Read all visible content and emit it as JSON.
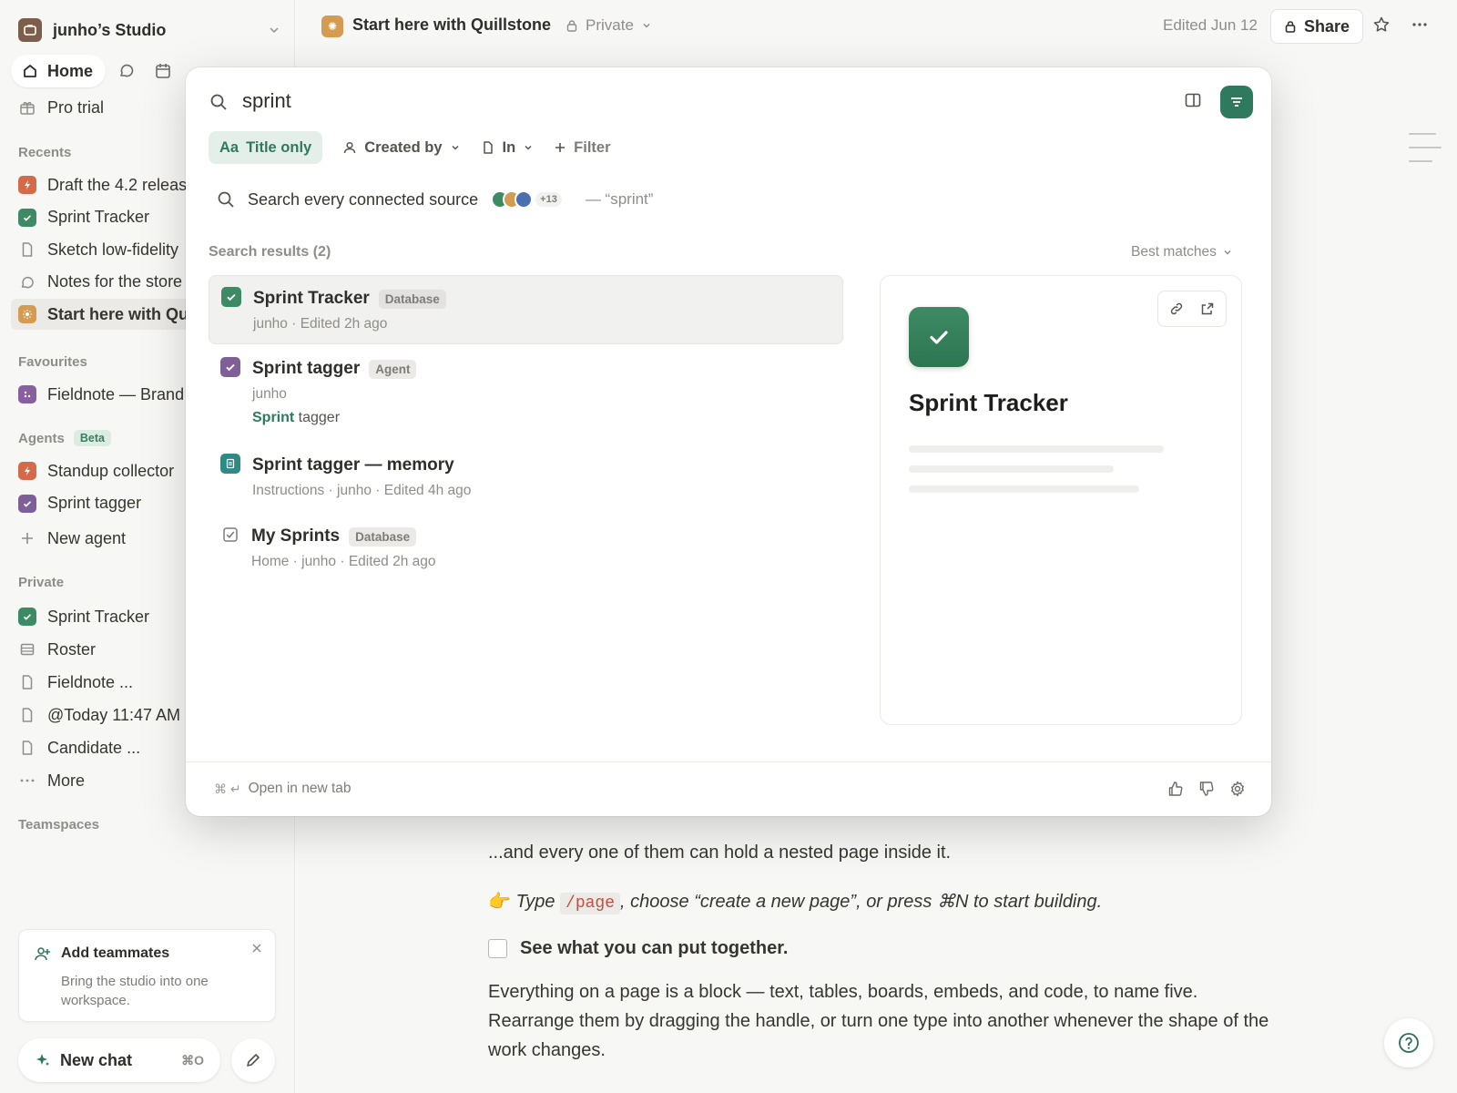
{
  "workspace": {
    "name": "junho’s Studio"
  },
  "nav": {
    "home_label": "Home"
  },
  "sidebar": {
    "pro_trial": "Pro trial",
    "recents_label": "Recents",
    "recents": [
      {
        "label": "Draft the 4.2 releas",
        "color": "#d46a4a",
        "icon": "bolt-icon"
      },
      {
        "label": "Sprint Tracker",
        "color": "#3d8b64",
        "icon": "check-icon"
      },
      {
        "label": "Sketch low-fidelity",
        "color": "",
        "icon": "page-icon"
      },
      {
        "label": "Notes for the store",
        "color": "",
        "icon": "chat-icon"
      },
      {
        "label": "Start here with Qu",
        "color": "#d49c53",
        "icon": "sun-icon"
      }
    ],
    "favourites_label": "Favourites",
    "favourites": [
      {
        "label": "Fieldnote — Brand",
        "color": "#8a5fa0",
        "icon": "dots-icon"
      }
    ],
    "agents_label": "Agents",
    "agents_badge": "Beta",
    "agents": [
      {
        "label": "Standup collector",
        "color": "#d46a4a",
        "icon": "bolt-icon"
      },
      {
        "label": "Sprint tagger",
        "color": "#7f5f97",
        "icon": "check-icon"
      }
    ],
    "new_agent": "New agent",
    "private_label": "Private",
    "private": [
      {
        "label": "Sprint Tracker",
        "color": "#3d8b64",
        "icon": "check-icon"
      },
      {
        "label": "Roster",
        "color": "",
        "icon": "table-icon"
      },
      {
        "label": "Fieldnote ...",
        "color": "",
        "icon": "page-icon"
      },
      {
        "label": "@Today 11:47 AM",
        "color": "",
        "icon": "page-icon"
      },
      {
        "label": "Candidate ...",
        "color": "",
        "icon": "page-icon"
      }
    ],
    "more": "More",
    "teamspaces_label": "Teamspaces",
    "teammates": {
      "title": "Add teammates",
      "body": "Bring the studio into one workspace."
    },
    "new_chat": "New chat",
    "new_chat_shortcut": "⌘O"
  },
  "page": {
    "title": "Start here with Quillstone",
    "privacy": "Private",
    "edited": "Edited Jun 12",
    "share": "Share",
    "body": {
      "p1": "...and every one of them can hold a nested page inside it.",
      "emoji": "👉",
      "p2_before": "Type",
      "p2_code": "/page",
      "p2_after": ", choose “create a new page”, or press ⌘N to start building.",
      "todo": "See what you can put together.",
      "p3": "Everything on a page is a block — text, tables, boards, embeds, and code, to name five. Rearrange them by dragging the handle, or turn one type into another whenever the shape of the work changes."
    }
  },
  "search": {
    "query": "sprint",
    "filters": {
      "title_only_prefix": "Aa",
      "title_only": "Title only",
      "created_by": "Created by",
      "in": "In",
      "filter": "Filter"
    },
    "connected": {
      "label": "Search every connected source",
      "more_count": "+13",
      "query_echo": "— “sprint”"
    },
    "results_label": "Search results (2)",
    "sort": "Best matches",
    "results": [
      {
        "title": "Sprint Tracker",
        "badge": "Database",
        "meta": "junho · Edited 2h ago"
      },
      {
        "title": "Sprint tagger",
        "badge": "Agent",
        "meta": "junho",
        "snippet_match": "Sprint",
        "snippet_rest": " tagger"
      },
      {
        "title": "Sprint tagger — memory",
        "meta": "Instructions · junho · Edited 4h ago"
      },
      {
        "title": "My Sprints",
        "badge": "Database",
        "meta": "Home · junho · Edited 2h ago"
      }
    ],
    "preview": {
      "title": "Sprint Tracker"
    },
    "footer": {
      "shortcut": "⌘ ↵",
      "hint": "Open in new tab"
    }
  },
  "colors": {
    "accent": "#2f7a5e",
    "accent_light": "#e3efe8"
  }
}
